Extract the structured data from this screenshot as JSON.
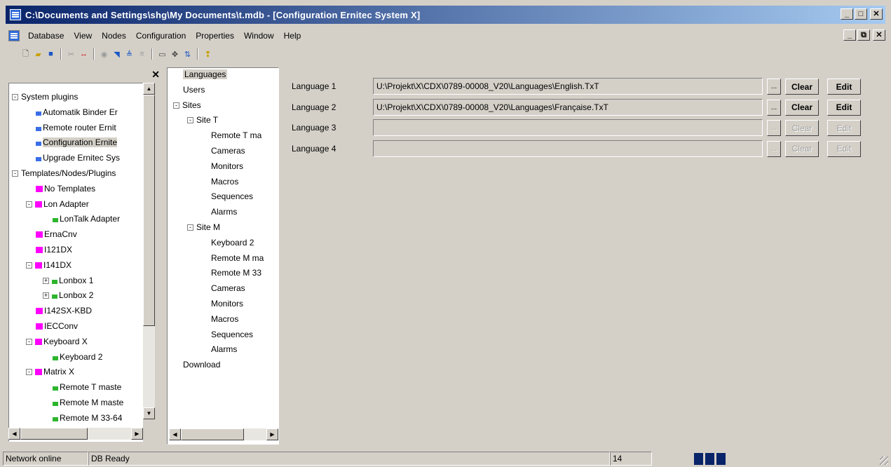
{
  "window": {
    "title": "C:\\Documents and Settings\\shg\\My Documents\\t.mdb - [Configuration Ernitec System X]",
    "controls": [
      "_",
      "□",
      "✕"
    ]
  },
  "menubar": {
    "items": [
      "Database",
      "View",
      "Nodes",
      "Configuration",
      "Properties",
      "Window",
      "Help"
    ],
    "mdi_controls": [
      "_",
      "⧉",
      "✕"
    ]
  },
  "toolbar": {
    "icons": [
      "new-icon",
      "open-icon",
      "save-icon",
      "cut-icon",
      "link-icon",
      "view-icon",
      "find-icon",
      "align-icon",
      "list-icon",
      "window-icon",
      "move-icon",
      "sort-icon",
      "help-icon"
    ]
  },
  "left_tree": {
    "close_label": "✕",
    "nodes": [
      {
        "label": "System plugins",
        "expander": "-"
      },
      {
        "label": "Automatik Binder Er",
        "icon": "blue-plugin-icon"
      },
      {
        "label": "Remote router Ernit",
        "icon": "blue-plugin-icon"
      },
      {
        "label": "Configuration Ernite",
        "icon": "blue-plugin-icon",
        "selected": true
      },
      {
        "label": "Upgrade Ernitec Sys",
        "icon": "blue-plugin-icon"
      },
      {
        "label": "Templates/Nodes/Plugins",
        "expander": "-"
      },
      {
        "label": "No Templates",
        "icon": "template-icon"
      },
      {
        "label": "Lon Adapter",
        "icon": "template-icon",
        "expander": "-"
      },
      {
        "label": "LonTalk Adapter",
        "icon": "node-icon"
      },
      {
        "label": "ErnaCnv",
        "icon": "template-icon"
      },
      {
        "label": "I121DX",
        "icon": "template-icon"
      },
      {
        "label": "I141DX",
        "icon": "template-icon",
        "expander": "-"
      },
      {
        "label": "Lonbox 1",
        "icon": "node-icon",
        "expander": "+"
      },
      {
        "label": "Lonbox 2",
        "icon": "node-icon",
        "expander": "+"
      },
      {
        "label": "I142SX-KBD",
        "icon": "template-icon"
      },
      {
        "label": "IECConv",
        "icon": "template-icon"
      },
      {
        "label": "Keyboard X",
        "icon": "template-icon",
        "expander": "-"
      },
      {
        "label": "Keyboard 2",
        "icon": "node-icon"
      },
      {
        "label": "Matrix X",
        "icon": "template-icon",
        "expander": "-"
      },
      {
        "label": "Remote T maste",
        "icon": "node-icon"
      },
      {
        "label": "Remote M maste",
        "icon": "node-icon"
      },
      {
        "label": "Remote M 33-64",
        "icon": "node-icon"
      }
    ]
  },
  "mid_tree": {
    "nodes": [
      {
        "label": "Languages",
        "selected": true
      },
      {
        "label": "Users"
      },
      {
        "label": "Sites",
        "expander": "-"
      },
      {
        "label": "Site T",
        "expander": "-"
      },
      {
        "label": "Remote T ma"
      },
      {
        "label": "Cameras"
      },
      {
        "label": "Monitors"
      },
      {
        "label": "Macros"
      },
      {
        "label": "Sequences"
      },
      {
        "label": "Alarms"
      },
      {
        "label": "Site M",
        "expander": "-"
      },
      {
        "label": "Keyboard 2"
      },
      {
        "label": "Remote M ma"
      },
      {
        "label": "Remote M 33"
      },
      {
        "label": "Cameras"
      },
      {
        "label": "Monitors"
      },
      {
        "label": "Macros"
      },
      {
        "label": "Sequences"
      },
      {
        "label": "Alarms"
      },
      {
        "label": "Download"
      }
    ]
  },
  "languages": [
    {
      "label": "Language 1",
      "path": "U:\\Projekt\\X\\CDX\\0789-00008_V20\\Languages\\English.TxT",
      "browse": "...",
      "clear": "Clear",
      "edit": "Edit",
      "enabled": true
    },
    {
      "label": "Language 2",
      "path": "U:\\Projekt\\X\\CDX\\0789-00008_V20\\Languages\\Française.TxT",
      "browse": "...",
      "clear": "Clear",
      "edit": "Edit",
      "enabled": true
    },
    {
      "label": "Language 3",
      "path": "",
      "browse": "...",
      "clear": "Clear",
      "edit": "Edit",
      "enabled": false
    },
    {
      "label": "Language 4",
      "path": "",
      "browse": "...",
      "clear": "Clear",
      "edit": "Edit",
      "enabled": false
    }
  ],
  "statusbar": {
    "network": "Network online",
    "db": "DB Ready",
    "count": "14",
    "progress_blocks": 3
  }
}
